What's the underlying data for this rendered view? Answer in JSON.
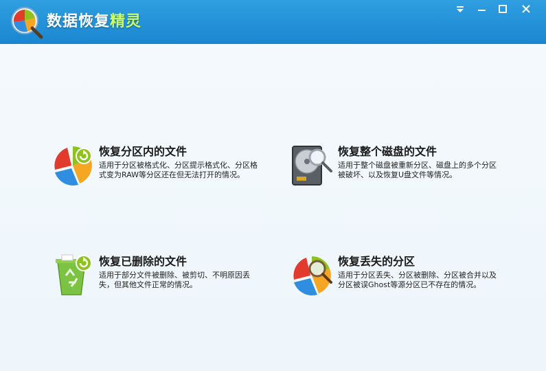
{
  "app": {
    "title_main": "数据恢复",
    "title_accent": "精灵",
    "icon": "app-logo-pie-magnifier",
    "accent_color": "#ccff66"
  },
  "window_controls": {
    "menu_icon": "dropdown-menu-icon",
    "minimize_icon": "minimize-icon",
    "maximize_icon": "maximize-icon",
    "close_icon": "close-icon"
  },
  "options": [
    {
      "title": "恢复分区内的文件",
      "description": "适用于分区被格式化、分区提示格式化、分区格式变为RAW等分区还在但无法打开的情况。",
      "icon": "pie-chart-refresh-icon"
    },
    {
      "title": "恢复整个磁盘的文件",
      "description": "适用于整个磁盘被重新分区、磁盘上的多个分区被破坏、以及恢复U盘文件等情况。",
      "icon": "hard-disk-magnifier-icon"
    },
    {
      "title": "恢复已删除的文件",
      "description": "适用于部分文件被删除、被剪切、不明原因丢失，但其他文件正常的情况。",
      "icon": "recycle-bin-refresh-icon"
    },
    {
      "title": "恢复丢失的分区",
      "description": "适用于分区丢失、分区被删除、分区被合并以及分区被误Ghost等源分区已不存在的情况。",
      "icon": "pie-chart-magnifier-icon"
    }
  ]
}
